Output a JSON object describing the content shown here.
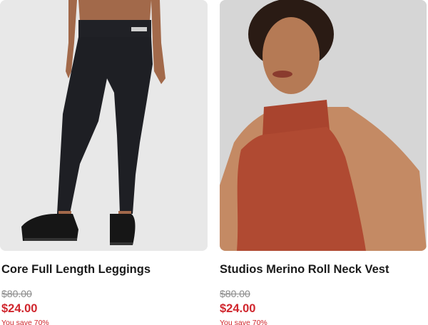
{
  "products": [
    {
      "image_alt": "leggings-model-photo",
      "title": "Core Full Length Leggings",
      "old_price": "$80.00",
      "new_price": "$24.00",
      "saving": "You save 70%"
    },
    {
      "image_alt": "roll-neck-vest-model-photo",
      "title": "Studios Merino Roll Neck Vest",
      "old_price": "$80.00",
      "new_price": "$24.00",
      "saving": "You save 70%"
    }
  ],
  "colors": {
    "sale_red": "#d0262d",
    "strike_gray": "#8a8a8a",
    "vest_rust": "#b04a32",
    "legging_black": "#1e1f24"
  }
}
